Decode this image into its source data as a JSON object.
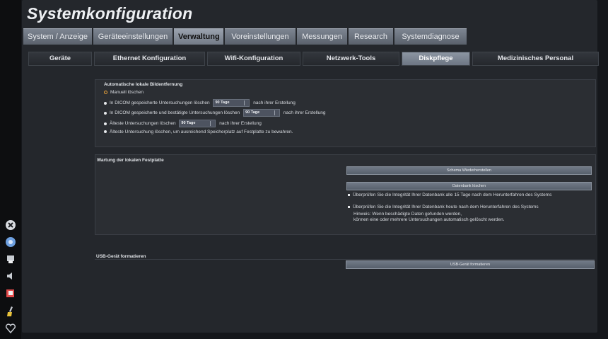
{
  "app_title": "Systemkonfiguration",
  "main_tabs": [
    {
      "label": "System / Anzeige"
    },
    {
      "label": "Geräteeinstellungen"
    },
    {
      "label": "Verwaltung",
      "active": true
    },
    {
      "label": "Voreinstellungen"
    },
    {
      "label": "Messungen"
    },
    {
      "label": "Research"
    },
    {
      "label": "Systemdiagnose"
    }
  ],
  "sub_tabs": [
    {
      "label": "Geräte"
    },
    {
      "label": "Ethernet Konfiguration"
    },
    {
      "label": "Wifi-Konfiguration"
    },
    {
      "label": "Netzwerk-Tools"
    },
    {
      "label": "Diskpflege",
      "active": true
    },
    {
      "label": "Medizinisches Personal"
    }
  ],
  "auto_delete": {
    "title": "Automatische lokale Bildentfernung",
    "manual": "Manuell löschen",
    "dicom_saved_prefix": "In DICOM gespeicherte Untersuchungen löschen",
    "dicom_saved_value": "90 Tage",
    "dicom_saved_suffix": "nach ihrer Erstellung",
    "dicom_confirmed_prefix": "In DICOM gespeicherte und bestätigte Untersuchungen löschen",
    "dicom_confirmed_value": "90 Tage",
    "dicom_confirmed_suffix": "nach ihrer Erstellung",
    "oldest_prefix": "Älteste Untersuchungen löschen",
    "oldest_value": "90 Tage",
    "oldest_suffix": "nach ihrer Erstellung",
    "oldest_space": "Älteste Untersuchung löschen, um ausreichend Speicherplatz auf Festplatte zu bewahren."
  },
  "maintenance": {
    "title": "Wartung der lokalen Festplatte",
    "restore_button": "Schema Wiederherstellen",
    "clean_button": "Datenbank löschen",
    "check15": "Überprüfen Sie die Integrität Ihrer Datenbank alle 15 Tage nach dem Herunterfahren des Systems",
    "check_today": "Überprüfen Sie die Integrität Ihrer Datenbank heute nach dem Herunterfahren des Systems",
    "hint1": "Hinweis: Wenn beschädigte Daten gefunden werden,",
    "hint2": "können eine oder mehrere Untersuchungen automatisch gelöscht werden."
  },
  "usb": {
    "title": "USB-Gerät formatieren",
    "button": "USB-Gerät formatieren"
  },
  "sidebar_icons": [
    "close-icon",
    "settings-icon",
    "printer-icon",
    "speaker-icon",
    "export-icon",
    "clean-icon",
    "heart-icon"
  ],
  "colors": {
    "accent": "#e8a23a",
    "active_tab": "#9aa2ae"
  }
}
